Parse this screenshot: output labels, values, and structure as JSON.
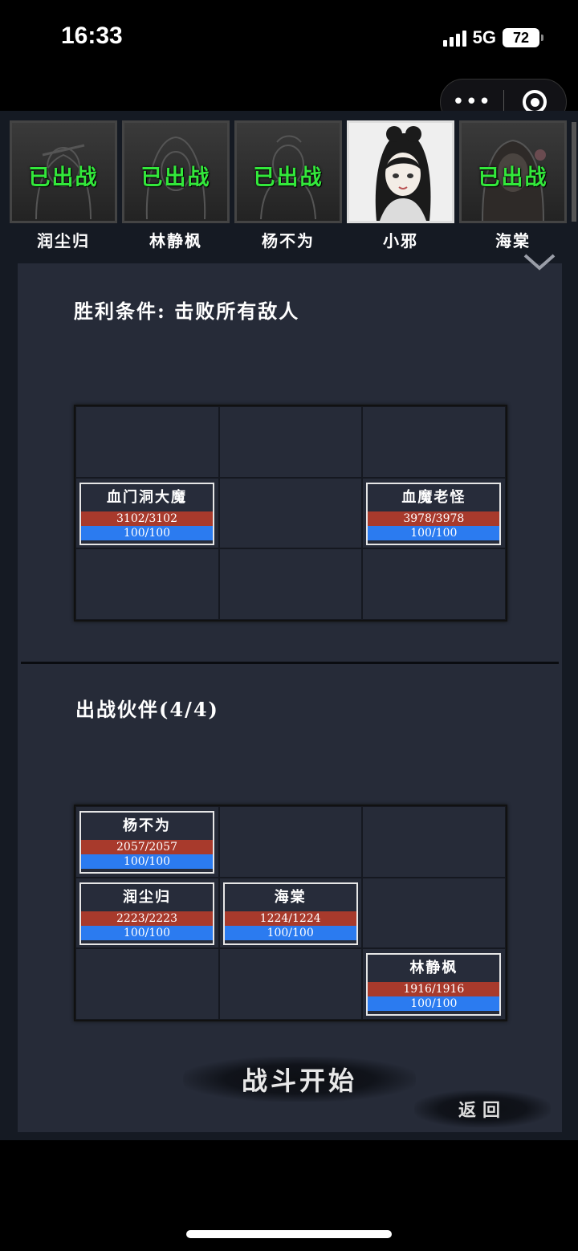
{
  "status_bar": {
    "time": "16:33",
    "network": "5G",
    "battery": "72"
  },
  "capsule": {
    "more_icon": "more-dots-icon",
    "close_icon": "target-circle-icon"
  },
  "roster": [
    {
      "name": "润尘归",
      "status": "已出战"
    },
    {
      "name": "林静枫",
      "status": "已出战"
    },
    {
      "name": "杨不为",
      "status": "已出战"
    },
    {
      "name": "小邪",
      "status": ""
    },
    {
      "name": "海棠",
      "status": "已出战"
    }
  ],
  "victory": {
    "label": "胜利条件: 击败所有敌人"
  },
  "enemies": [
    {
      "name": "血门洞大魔",
      "hp": "3102/3102",
      "mp": "100/100"
    },
    {
      "name": "血魔老怪",
      "hp": "3978/3978",
      "mp": "100/100"
    }
  ],
  "party": {
    "title": "出战伙伴(4/4)",
    "members": [
      {
        "name": "杨不为",
        "hp": "2057/2057",
        "mp": "100/100"
      },
      {
        "name": "润尘归",
        "hp": "2223/2223",
        "mp": "100/100"
      },
      {
        "name": "海棠",
        "hp": "1224/1224",
        "mp": "100/100"
      },
      {
        "name": "林静枫",
        "hp": "1916/1916",
        "mp": "100/100"
      }
    ]
  },
  "actions": {
    "start": "战斗开始",
    "back": "返回"
  },
  "colors": {
    "deployed": "#33e83b",
    "hp_bar": "#a83a2c",
    "mp_bar": "#2b7bf0",
    "panel": "#262b38"
  }
}
